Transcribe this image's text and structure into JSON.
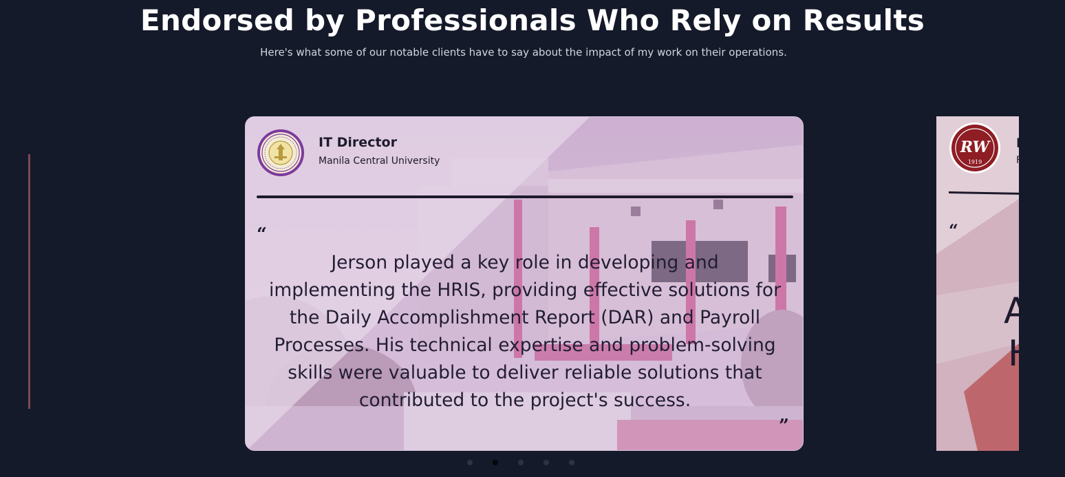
{
  "section": {
    "title": "Endorsed by Professionals Who Rely on Results",
    "subtitle": "Here's what some of our notable clients have to say about the impact of my work on their operations."
  },
  "testimonials": [
    {
      "role": "IT Director",
      "organization": "Manila Central University",
      "quote_open": "“",
      "quote": "Jerson played a key role in developing and implementing the HRIS, providing effective solutions for the Daily Accomplishment Report (DAR) and Payroll Processes. His technical expertise and problem-solving skills were valuable to deliver reliable solutions that contributed to the project's success.",
      "quote_close": "”",
      "logo_icon": "mcu-seal-icon"
    }
  ],
  "next_slide": {
    "logo_icon": "rw-1919-logo-icon",
    "logo_text": "RW",
    "logo_year": "1919",
    "role_partial": "I",
    "org_partial": "F",
    "quote_open": "“",
    "text_partial_line1": "A",
    "text_partial_line2": "H"
  },
  "pagination": {
    "count": 5,
    "active_index": 1
  },
  "colors": {
    "page_background": "#141a2a",
    "card_tint": "#d8c1dc",
    "text_dark": "#1d1a2d",
    "dot_active": "#05070d",
    "dot_inactive": "#2d3346"
  }
}
